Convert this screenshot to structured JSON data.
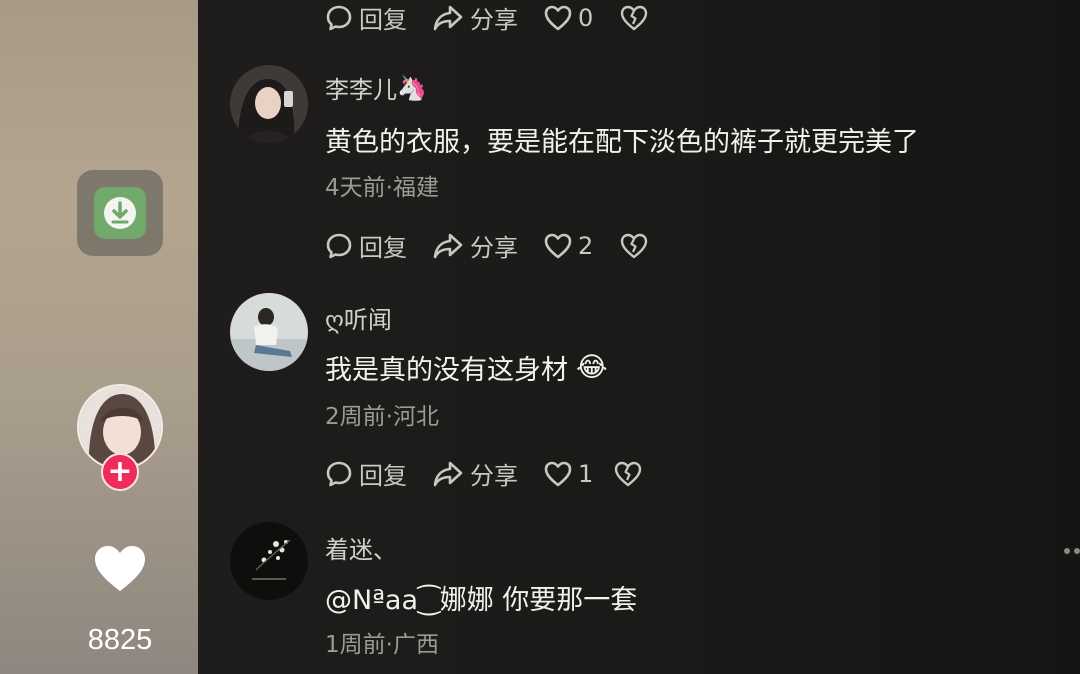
{
  "creator": {
    "likes": "8825"
  },
  "action_labels": {
    "reply": "回复",
    "share": "分享"
  },
  "top_actions": {
    "likes": "0"
  },
  "comments": [
    {
      "username": "李李儿",
      "username_emoji": "🦄",
      "text": "黄色的衣服，要是能在配下淡色的裤子就更完美了",
      "meta": "4天前·福建",
      "likes": "2"
    },
    {
      "username": "ღ听闻",
      "text": "我是真的没有这身材",
      "text_emoji": "😂",
      "meta": "2周前·河北",
      "likes": "1"
    },
    {
      "username": "着迷、",
      "text": "@Nªaa⁐娜娜  你要那一套",
      "meta": "1周前·广西"
    }
  ],
  "icons": {
    "download": "download-icon",
    "follow": "plus-icon",
    "like": "heart-icon",
    "reply": "comment-bubble-icon",
    "share": "share-arrow-icon",
    "comment_like": "heart-outline-icon",
    "dislike": "broken-heart-icon",
    "more": "more-icon"
  },
  "colors": {
    "accent_follow": "#ef2b57",
    "download_green": "#71a86b"
  }
}
